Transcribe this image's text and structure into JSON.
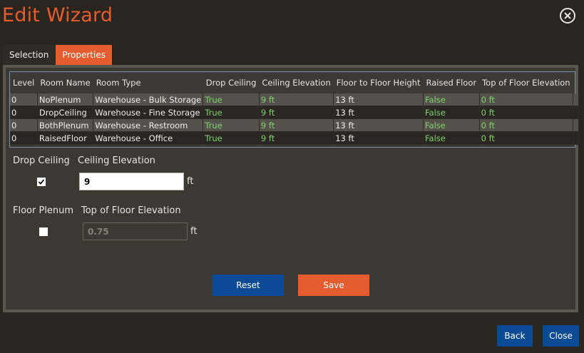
{
  "title": "Edit Wizard",
  "tabs": [
    {
      "label": "Selection"
    },
    {
      "label": "Properties"
    }
  ],
  "table": {
    "columns": [
      "Level",
      "Room Name",
      "Room Type",
      "Drop Ceiling",
      "Ceiling Elevation",
      "Floor to Floor Height",
      "Raised Floor",
      "Top of Floor Elevation"
    ],
    "rows": [
      [
        "0",
        "NoPlenum",
        "Warehouse - Bulk Storage",
        "True",
        "9 ft",
        "13 ft",
        "False",
        "0 ft"
      ],
      [
        "0",
        "DropCeiling",
        "Warehouse - Fine Storage",
        "True",
        "9 ft",
        "13 ft",
        "False",
        "0 ft"
      ],
      [
        "0",
        "BothPlenum",
        "Warehouse - Restroom",
        "True",
        "9 ft",
        "13 ft",
        "False",
        "0 ft"
      ],
      [
        "0",
        "RaisedFloor",
        "Warehouse - Office",
        "True",
        "9 ft",
        "13 ft",
        "False",
        "0 ft"
      ]
    ]
  },
  "form": {
    "drop_ceiling_label": "Drop Ceiling",
    "drop_ceiling_checked": true,
    "ceiling_elevation_label": "Ceiling Elevation",
    "ceiling_elevation_value": "9",
    "ceiling_elevation_unit": "ft",
    "floor_plenum_label": "Floor Plenum",
    "floor_plenum_checked": false,
    "top_floor_label": "Top of Floor Elevation",
    "top_floor_value": "0.75",
    "top_floor_unit": "ft"
  },
  "buttons": {
    "reset": "Reset",
    "save": "Save",
    "back": "Back",
    "close": "Close"
  },
  "colors": {
    "accent": "#e55c2f",
    "primary_button": "#0b4a94",
    "value_green": "#7ed36d"
  }
}
